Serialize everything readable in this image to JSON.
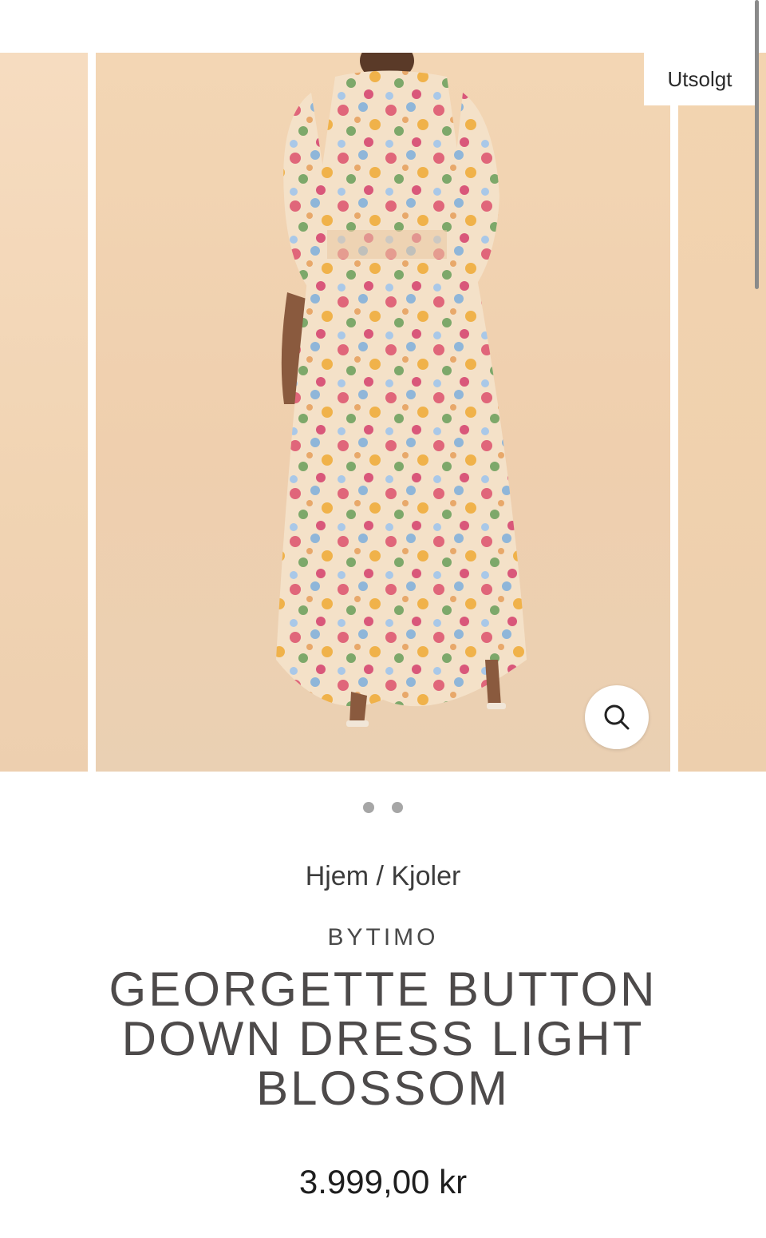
{
  "gallery": {
    "badge": "Utsolgt",
    "zoom_icon": "search-icon",
    "dots": 2
  },
  "breadcrumb": {
    "home": "Hjem",
    "separator": " / ",
    "category": "Kjoler"
  },
  "product": {
    "brand": "BYTIMO",
    "title": "GEORGETTE BUTTON DOWN DRESS LIGHT BLOSSOM",
    "price": "3.999,00 kr"
  },
  "colors": {
    "background": "#ffffff",
    "image_backdrop": "#f2d5b4",
    "title": "#4d4a4a",
    "dot": "#a6a6a6"
  }
}
